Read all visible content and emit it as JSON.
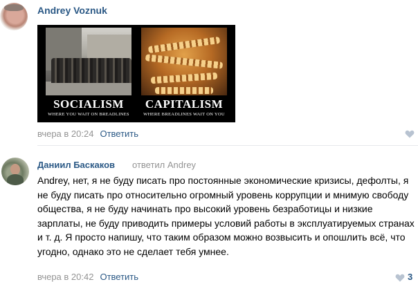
{
  "comments": [
    {
      "author": "Andrey Voznuk",
      "avatar": "avatar-photo",
      "meme": {
        "left_title": "SOCIALISM",
        "left_subtitle": "WHERE YOU WAIT ON BREADLINES",
        "right_title": "CAPITALISM",
        "right_subtitle": "WHERE BREADLINES WAIT ON YOU"
      },
      "timestamp": "вчера в 20:24",
      "reply_label": "Ответить",
      "like_icon": "heart-icon",
      "likes": ""
    },
    {
      "author": "Даниил Баскаков",
      "replied_to": "ответил Andrey",
      "avatar": "avatar-photo",
      "text": "Andrey, нет, я не буду писать про постоянные экономические кризисы, дефолты, я не буду писать про относительно огромный уровень коррупции и мнимую свободу общества, я не буду начинать про высокий уровень безработицы и низкие зарплаты, не буду приводить примеры условий работы в эксплуатируемых странах и т. д. Я просто напишу, что таким образом можно возвысить и опошлить всё, что угодно, однако это не сделает тебя умнее.",
      "timestamp": "вчера в 20:42",
      "reply_label": "Ответить",
      "like_icon": "heart-icon",
      "likes": "3"
    }
  ],
  "colors": {
    "link": "#2a5885",
    "muted": "#939393",
    "heart": "#b8c3d1",
    "divider": "#e7e8ec"
  }
}
